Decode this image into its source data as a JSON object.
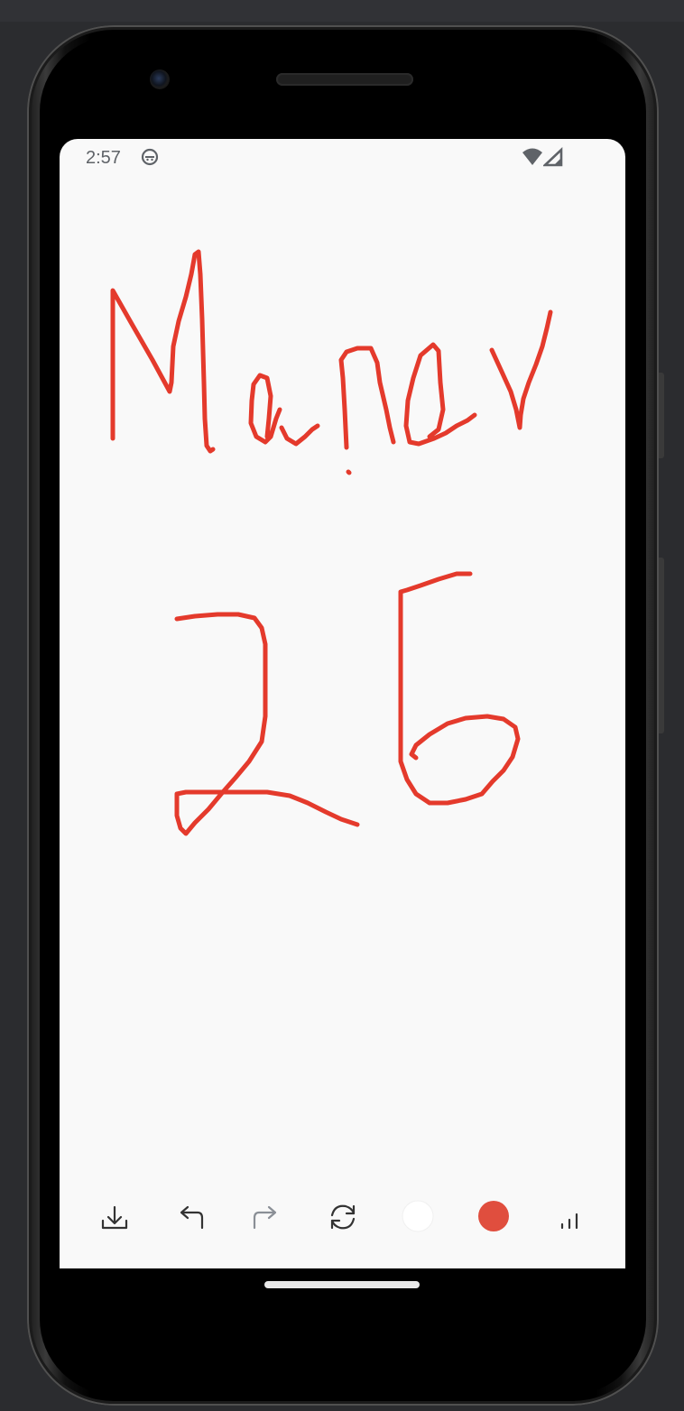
{
  "statusbar": {
    "time": "2:57",
    "icons": [
      "face-icon",
      "wifi-icon",
      "cellular-signal-icon"
    ]
  },
  "canvas": {
    "stroke_color": "#e43a2c",
    "drawn_content": [
      "Manav",
      "26"
    ]
  },
  "toolbar": {
    "tools": [
      {
        "name": "download-icon",
        "state": "enabled"
      },
      {
        "name": "undo-icon",
        "state": "enabled"
      },
      {
        "name": "redo-icon",
        "state": "disabled"
      },
      {
        "name": "reset-icon",
        "state": "enabled"
      },
      {
        "name": "white-color-swatch",
        "color": "#ffffff"
      },
      {
        "name": "red-color-swatch",
        "color": "#e04e3e"
      },
      {
        "name": "stroke-width-icon",
        "state": "enabled"
      }
    ]
  },
  "colors": {
    "accent_red": "#e43a2c",
    "selected_swatch": "#e04e3e",
    "screen_background": "#f9f9f9"
  }
}
